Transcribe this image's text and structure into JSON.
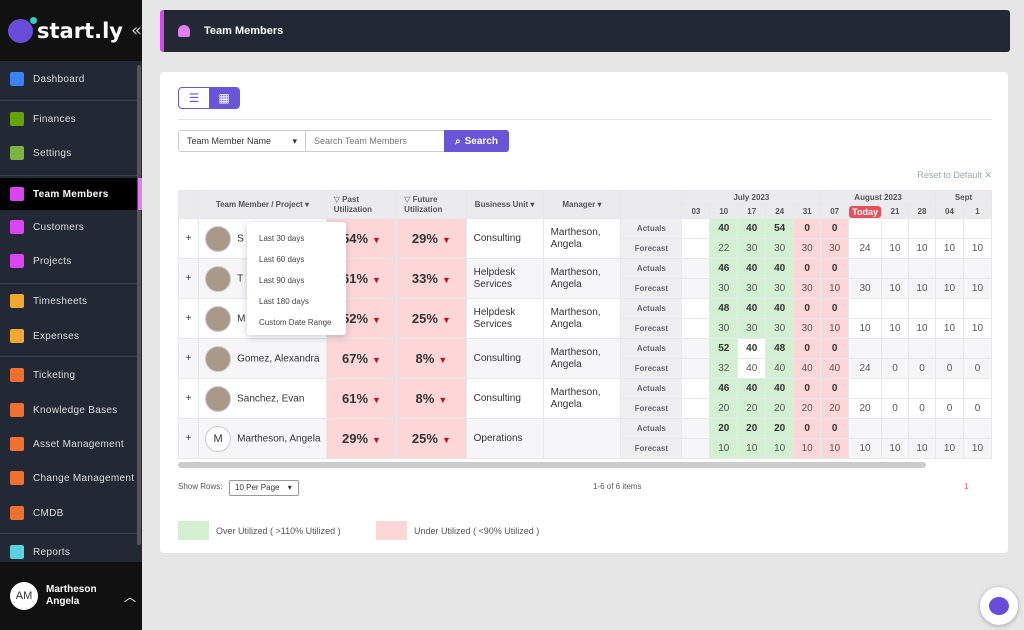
{
  "brand": {
    "name": "start.ly"
  },
  "sidebar": {
    "items": [
      {
        "label": "Dashboard",
        "icon": "dashboard-icon",
        "color": "#3b82f6"
      },
      {
        "label": "Finances",
        "icon": "chart-icon",
        "color": "#65a30d"
      },
      {
        "label": "Settings",
        "icon": "gear-icon",
        "color": "#7cb342"
      },
      {
        "label": "Team Members",
        "icon": "person-icon",
        "color": "#d946ef",
        "active": true
      },
      {
        "label": "Customers",
        "icon": "building-icon",
        "color": "#d946ef"
      },
      {
        "label": "Projects",
        "icon": "briefcase-icon",
        "color": "#d946ef"
      },
      {
        "label": "Timesheets",
        "icon": "clock-icon",
        "color": "#f0a830"
      },
      {
        "label": "Expenses",
        "icon": "dollar-icon",
        "color": "#f0a830"
      },
      {
        "label": "Ticketing",
        "icon": "ticket-icon",
        "color": "#f07030"
      },
      {
        "label": "Knowledge Bases",
        "icon": "graduation-cap-icon",
        "color": "#f07030"
      },
      {
        "label": "Asset Management",
        "icon": "laptop-icon",
        "color": "#f07030"
      },
      {
        "label": "Change Management",
        "icon": "arrows-icon",
        "color": "#f07030"
      },
      {
        "label": "CMDB",
        "icon": "database-icon",
        "color": "#f07030"
      },
      {
        "label": "Reports",
        "icon": "pie-chart-icon",
        "color": "#5ad0e0"
      }
    ],
    "user": {
      "initials": "AM",
      "name": "Martheson Angela"
    }
  },
  "header": {
    "title": "Team Members"
  },
  "toolbar": {
    "filter_select": "Team Member Name",
    "search_placeholder": "Search Team Members",
    "search_label": "Search",
    "reset": "Reset to Default"
  },
  "table": {
    "headers": {
      "member": "Team Member / Project",
      "past": "Past Utilization",
      "future": "Future Utilization",
      "bu": "Business Unit",
      "manager": "Manager"
    },
    "months": [
      {
        "label": "July 2023",
        "span": 5
      },
      {
        "label": "August 2023",
        "span": 4
      },
      {
        "label": "Sept",
        "span": 2
      }
    ],
    "dates": [
      "03",
      "10",
      "17",
      "24",
      "31",
      "07",
      "Today",
      "21",
      "28",
      "04",
      "1"
    ],
    "labels": {
      "actuals": "Actuals",
      "forecast": "Forecast"
    },
    "rows": [
      {
        "name": "S",
        "avatar": "",
        "past": "54%",
        "future": "29%",
        "bu": "Consulting",
        "manager": "Martheson, Angela",
        "actuals": [
          "",
          "40",
          "40",
          "54",
          "0",
          "0",
          "",
          "",
          "",
          "",
          ""
        ],
        "forecast": [
          "",
          "22",
          "30",
          "30",
          "30",
          "30",
          "24",
          "10",
          "10",
          "10",
          "10"
        ]
      },
      {
        "name": "T",
        "avatar": "",
        "past": "61%",
        "future": "33%",
        "bu": "Helpdesk Services",
        "manager": "Martheson, Angela",
        "actuals": [
          "",
          "46",
          "40",
          "40",
          "0",
          "0",
          "",
          "",
          "",
          "",
          ""
        ],
        "forecast": [
          "",
          "30",
          "30",
          "30",
          "30",
          "10",
          "30",
          "10",
          "10",
          "10",
          "10"
        ]
      },
      {
        "name": "M",
        "avatar": "",
        "past": "52%",
        "future": "25%",
        "bu": "Helpdesk Services",
        "manager": "Martheson, Angela",
        "actuals": [
          "",
          "48",
          "40",
          "40",
          "0",
          "0",
          "",
          "",
          "",
          "",
          ""
        ],
        "forecast": [
          "",
          "30",
          "30",
          "30",
          "30",
          "10",
          "10",
          "10",
          "10",
          "10",
          "10"
        ]
      },
      {
        "name": "Gomez, Alexandra",
        "avatar": "",
        "past": "67%",
        "future": "8%",
        "bu": "Consulting",
        "manager": "Martheson, Angela",
        "actuals": [
          "",
          "52",
          "40",
          "48",
          "0",
          "0",
          "",
          "",
          "",
          "",
          ""
        ],
        "forecast": [
          "",
          "32",
          "40",
          "40",
          "40",
          "40",
          "24",
          "0",
          "0",
          "0",
          "0"
        ],
        "white_col": 2
      },
      {
        "name": "Sanchez, Evan",
        "avatar": "",
        "past": "61%",
        "future": "8%",
        "bu": "Consulting",
        "manager": "Martheson, Angela",
        "actuals": [
          "",
          "46",
          "40",
          "40",
          "0",
          "0",
          "",
          "",
          "",
          "",
          ""
        ],
        "forecast": [
          "",
          "20",
          "20",
          "20",
          "20",
          "20",
          "20",
          "0",
          "0",
          "0",
          "0"
        ]
      },
      {
        "name": "Martheson, Angela",
        "avatar": "M",
        "past": "29%",
        "future": "25%",
        "bu": "Operations",
        "manager": "",
        "actuals": [
          "",
          "20",
          "20",
          "20",
          "0",
          "0",
          "",
          "",
          "",
          "",
          ""
        ],
        "forecast": [
          "",
          "10",
          "10",
          "10",
          "10",
          "10",
          "10",
          "10",
          "10",
          "10",
          "10"
        ]
      }
    ]
  },
  "dropdown": [
    "Last 30 days",
    "Last 60 days",
    "Last 90 days",
    "Last 180 days",
    "Custom Date Range"
  ],
  "footer": {
    "show_rows": "Show Rows:",
    "per_page": "10 Per Page",
    "count": "1-6 of 6 items",
    "page": "1"
  },
  "legend": [
    {
      "label": "Over Utilized ( >110% Utilized )",
      "color": "#d4f0d2"
    },
    {
      "label": "Under Utilized ( <90% Utilized )",
      "color": "#fdd7d7"
    }
  ]
}
